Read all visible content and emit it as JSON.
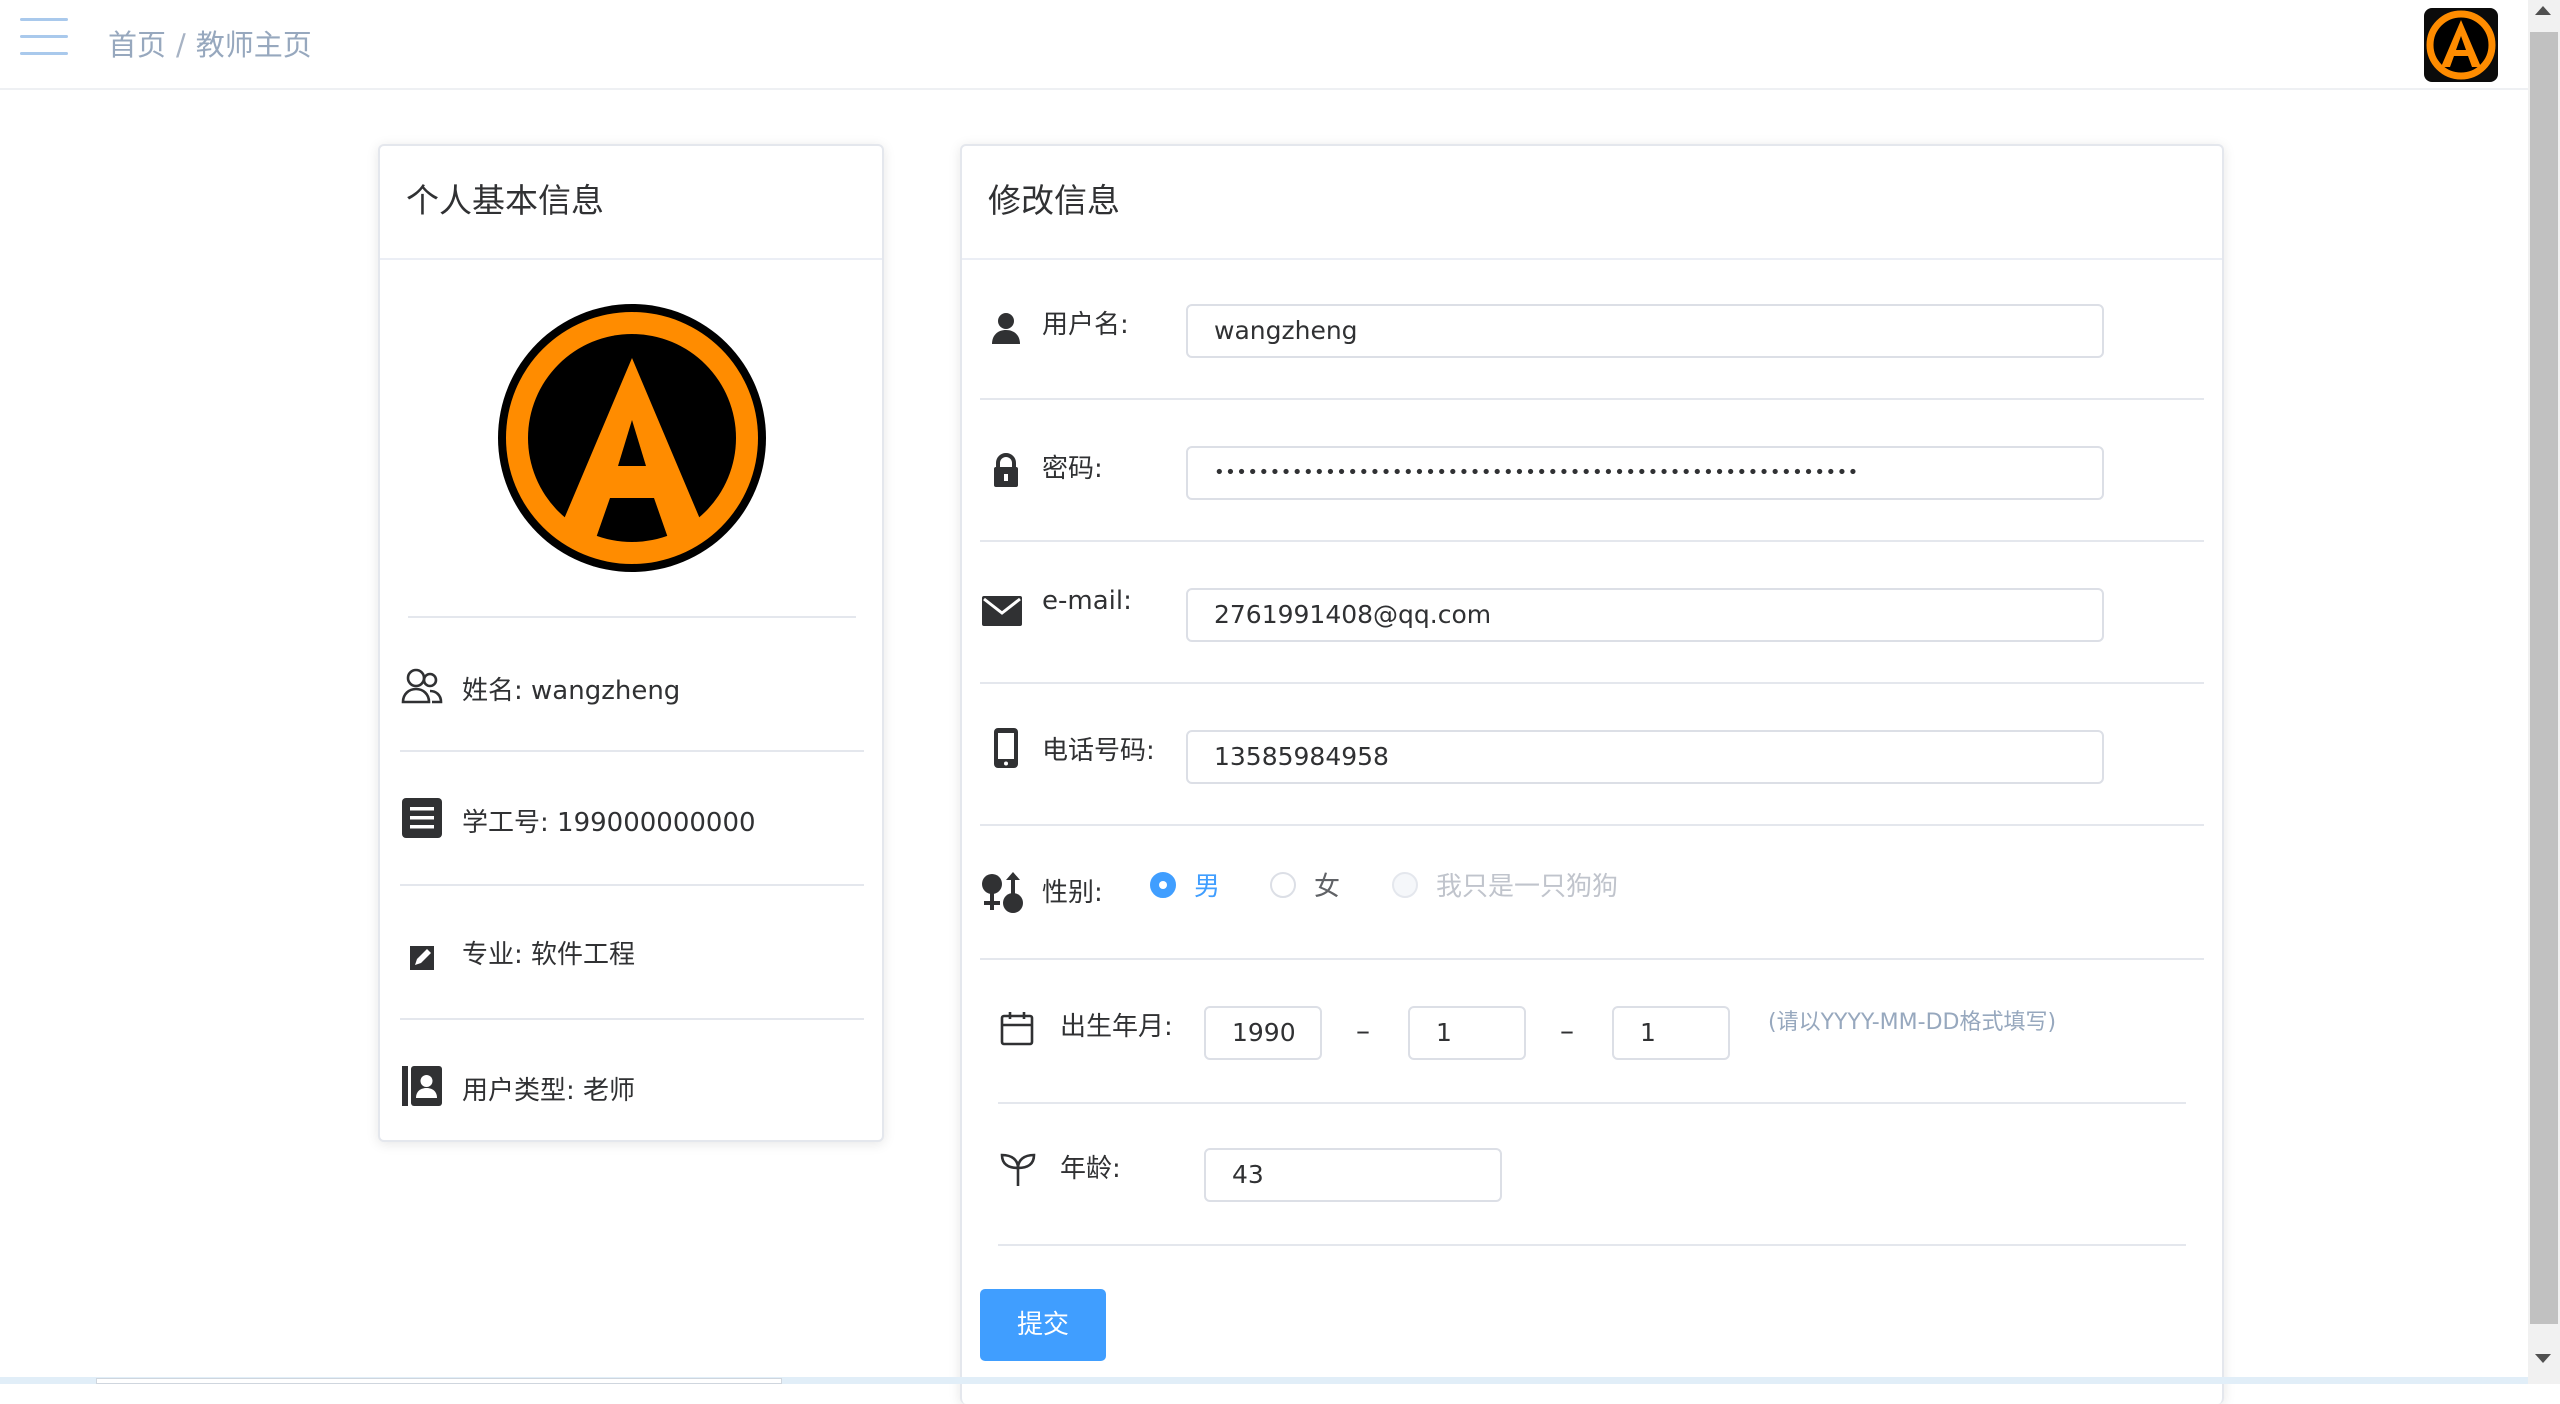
{
  "header": {
    "breadcrumb": [
      "首页",
      "教师主页"
    ],
    "separator": "/",
    "menu_icon": "hamburger-menu-icon",
    "avatar_icon": "anarchy-logo-avatar"
  },
  "profile_card": {
    "title": "个人基本信息",
    "avatar_icon": "anarchy-logo-avatar",
    "rows": [
      {
        "icon": "user-group-icon",
        "text": "姓名: wangzheng"
      },
      {
        "icon": "document-list-icon",
        "text": "学工号: 199000000000"
      },
      {
        "icon": "edit-icon",
        "text": "专业: 软件工程"
      },
      {
        "icon": "contact-book-icon",
        "text": "用户类型: 老师"
      }
    ]
  },
  "edit_card": {
    "title": "修改信息",
    "username": {
      "label": "用户名:",
      "value": "wangzheng",
      "icon": "user-icon"
    },
    "password": {
      "label": "密码:",
      "value": "••••••••••••••••••••••••••••••••••••••••••••••••••••••••••",
      "icon": "lock-icon"
    },
    "email": {
      "label": "e-mail:",
      "value": "2761991408@qq.com",
      "icon": "envelope-icon"
    },
    "phone": {
      "label": "电话号码:",
      "value": "13585984958",
      "icon": "mobile-phone-icon"
    },
    "gender": {
      "label": "性别:",
      "icon": "gender-icon",
      "options": [
        {
          "label": "男",
          "state": "checked"
        },
        {
          "label": "女",
          "state": "unchecked"
        },
        {
          "label": "我只是一只狗狗",
          "state": "disabled"
        }
      ]
    },
    "birth": {
      "label": "出生年月:",
      "icon": "calendar-icon",
      "year": "1990",
      "month": "1",
      "day": "1",
      "dash": "–",
      "hint": "(请以YYYY-MM-DD格式填写)"
    },
    "age": {
      "label": "年龄:",
      "value": "43",
      "icon": "sprout-icon"
    },
    "submit_label": "提交"
  },
  "colors": {
    "primary": "#409eff",
    "border": "#e4e7ed",
    "breadcrumb": "#97a8be",
    "logo_orange": "#ff8c00",
    "logo_black": "#000000"
  }
}
